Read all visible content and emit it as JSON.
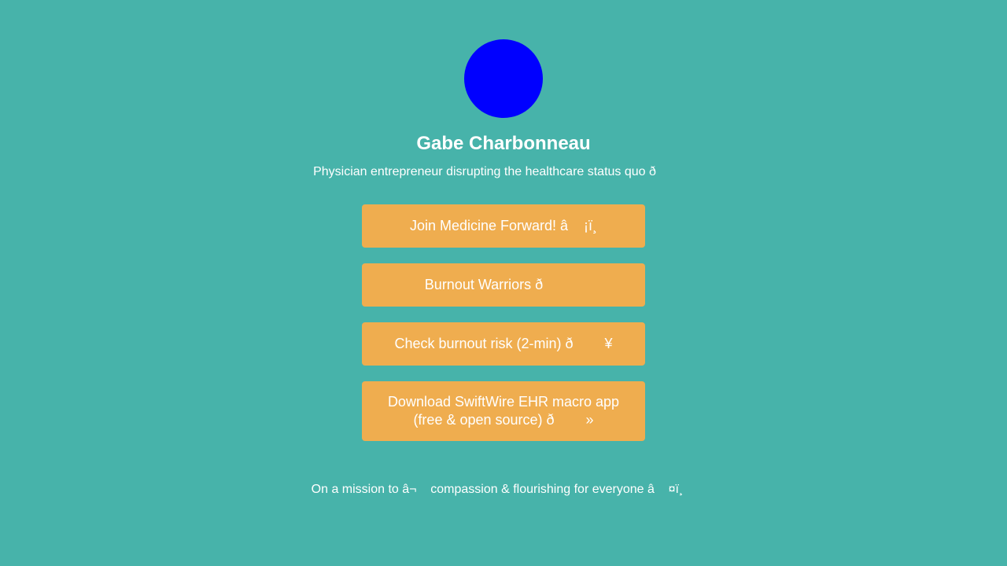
{
  "profile": {
    "name": "Gabe Charbonneau",
    "bio": "Physician entrepreneur disrupting the healthcare status quo ð",
    "avatar_color": "#0000ff"
  },
  "links": [
    {
      "label": "Join Medicine Forward! â    ¡ï¸"
    },
    {
      "label": "Burnout Warriors ð          "
    },
    {
      "label": "Check burnout risk (2-min) ð        ¥"
    },
    {
      "label": "Download SwiftWire EHR macro app (free & open source) ð        »"
    }
  ],
  "footer": {
    "text": "On a mission to â¬    compassion & flourishing for everyone â    ¤ï¸"
  },
  "colors": {
    "background": "#47b3aa",
    "button": "#efad4f",
    "text": "#ffffff"
  }
}
